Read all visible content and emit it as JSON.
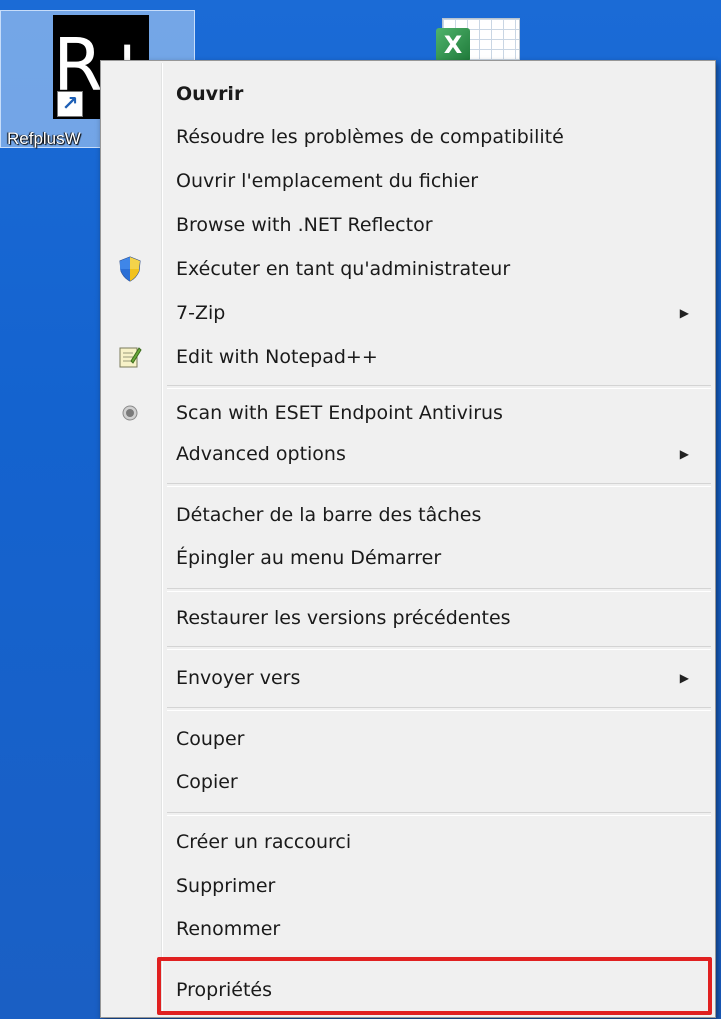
{
  "desktop": {
    "refplus_icon": {
      "logo_text": "R+",
      "label": "RefplusW"
    }
  },
  "menu": {
    "items": [
      {
        "label": "Ouvrir",
        "bold": true
      },
      {
        "label": "Résoudre les problèmes de compatibilité"
      },
      {
        "label": "Ouvrir l'emplacement du fichier"
      },
      {
        "label": "Browse with .NET Reflector"
      },
      {
        "label": "Exécuter en tant qu'administrateur",
        "icon": "uac-shield-icon"
      },
      {
        "label": "7-Zip",
        "submenu": true
      },
      {
        "label": "Edit with Notepad++",
        "icon": "notepad-plus-plus-icon"
      },
      {
        "label": "Scan with ESET Endpoint Antivirus",
        "icon": "eset-icon"
      },
      {
        "label": "Advanced options",
        "submenu": true
      },
      {
        "label": "Détacher de la barre des tâches"
      },
      {
        "label": "Épingler au menu Démarrer"
      },
      {
        "label": "Restaurer les versions précédentes"
      },
      {
        "label": "Envoyer vers",
        "submenu": true
      },
      {
        "label": "Couper"
      },
      {
        "label": "Copier"
      },
      {
        "label": "Créer un raccourci"
      },
      {
        "label": "Supprimer"
      },
      {
        "label": "Renommer"
      },
      {
        "label": "Propriétés",
        "highlighted": true
      }
    ],
    "highlight_color": "#e02020"
  }
}
